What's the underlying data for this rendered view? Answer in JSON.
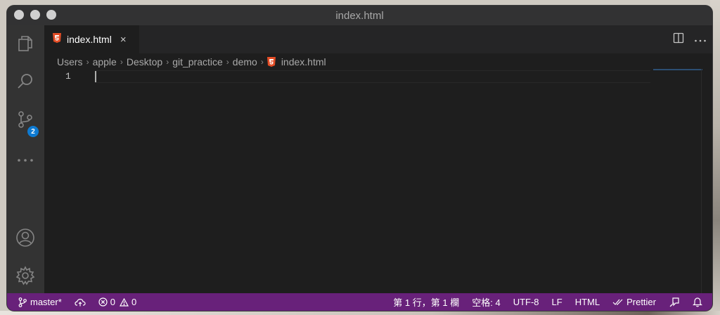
{
  "window": {
    "title": "index.html"
  },
  "activity_bar": {
    "items": [
      "explorer-icon",
      "search-icon",
      "source-control-icon",
      "more-icon"
    ],
    "source_control_badge": "2",
    "bottom_items": [
      "account-icon",
      "settings-gear-icon"
    ]
  },
  "tabs": [
    {
      "label": "index.html",
      "close": "×",
      "icon": "html5-icon"
    }
  ],
  "breadcrumb": {
    "items": [
      "Users",
      "apple",
      "Desktop",
      "git_practice",
      "demo",
      "index.html"
    ],
    "separator": "›"
  },
  "editor": {
    "line_numbers": [
      "1"
    ]
  },
  "status_bar": {
    "branch": "master*",
    "errors": "0",
    "warnings": "0",
    "position": "第 1 行，第 1 欄",
    "indent": "空格: 4",
    "encoding": "UTF-8",
    "eol": "LF",
    "language": "HTML",
    "formatter": "Prettier"
  },
  "colors": {
    "status_bar": "#68217a",
    "editor_bg": "#1e1e1e",
    "badge": "#0e7ad1",
    "html_icon": "#e44d26"
  }
}
